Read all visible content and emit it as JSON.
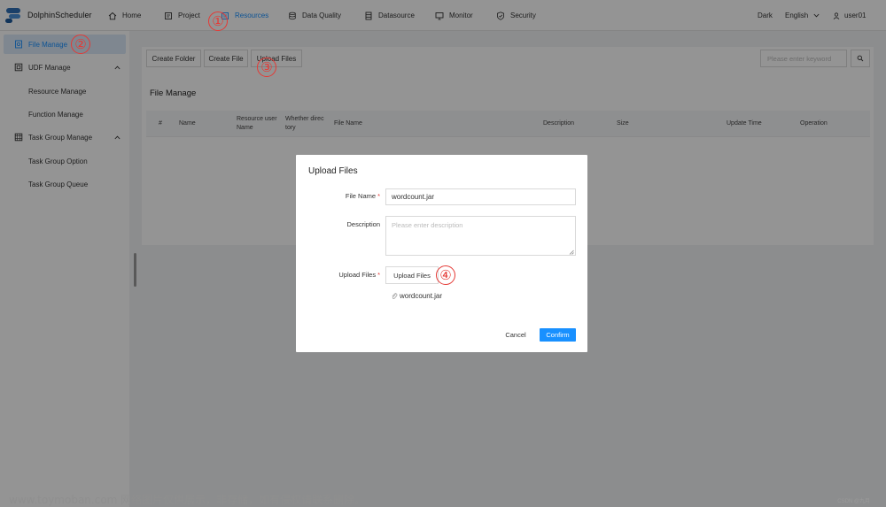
{
  "app": {
    "name": "DolphinScheduler"
  },
  "nav": {
    "items": [
      {
        "label": "Home",
        "icon": "home-icon"
      },
      {
        "label": "Project",
        "icon": "project-icon"
      },
      {
        "label": "Resources",
        "icon": "resources-icon",
        "active": true
      },
      {
        "label": "Data Quality",
        "icon": "data-quality-icon"
      },
      {
        "label": "Datasource",
        "icon": "datasource-icon"
      },
      {
        "label": "Monitor",
        "icon": "monitor-icon"
      },
      {
        "label": "Security",
        "icon": "security-icon"
      }
    ],
    "theme": "Dark",
    "language": "English",
    "user": "user01"
  },
  "sidebar": {
    "items": [
      {
        "label": "File Manage",
        "icon": "file-manage-icon",
        "active": true
      },
      {
        "label": "UDF Manage",
        "icon": "udf-icon",
        "expanded": true
      },
      {
        "label": "Resource Manage"
      },
      {
        "label": "Function Manage"
      },
      {
        "label": "Task Group Manage",
        "icon": "task-group-icon",
        "expanded": true
      },
      {
        "label": "Task Group Option"
      },
      {
        "label": "Task Group Queue"
      }
    ]
  },
  "toolbar": {
    "create_folder": "Create Folder",
    "create_file": "Create File",
    "upload_files": "Upload Files",
    "search_placeholder": "Please enter keyword"
  },
  "table": {
    "title": "File Manage",
    "columns": [
      "#",
      "Name",
      "Resource user Name",
      "Whether directory",
      "File Name",
      "Description",
      "Size",
      "Update Time",
      "Operation"
    ],
    "column_lines": [
      [
        "#"
      ],
      [
        "Name"
      ],
      [
        "Resource user",
        "Name"
      ],
      [
        "Whether direc",
        "tory"
      ],
      [
        "File Name"
      ],
      [
        "Description"
      ],
      [
        "Size"
      ],
      [
        "Update Time"
      ],
      [
        "Operation"
      ]
    ]
  },
  "modal": {
    "title": "Upload Files",
    "file_name_label": "File Name",
    "file_name_value": "wordcount.jar",
    "description_label": "Description",
    "description_placeholder": "Please enter description",
    "upload_label": "Upload Files",
    "upload_button": "Upload Files",
    "uploaded_file": "wordcount.jar",
    "cancel": "Cancel",
    "confirm": "Confirm"
  },
  "annotations": [
    "①",
    "②",
    "③",
    "④"
  ],
  "watermark": "www.toymoban.com 网络图片仅供展示，非存储，如有侵权请联系删除。",
  "credit": "CSDN @九月",
  "colors": {
    "accent": "#1890ff",
    "annotation": "#e53935",
    "sidebar_active_bg": "#dbe9f8",
    "required": "#e53935"
  }
}
